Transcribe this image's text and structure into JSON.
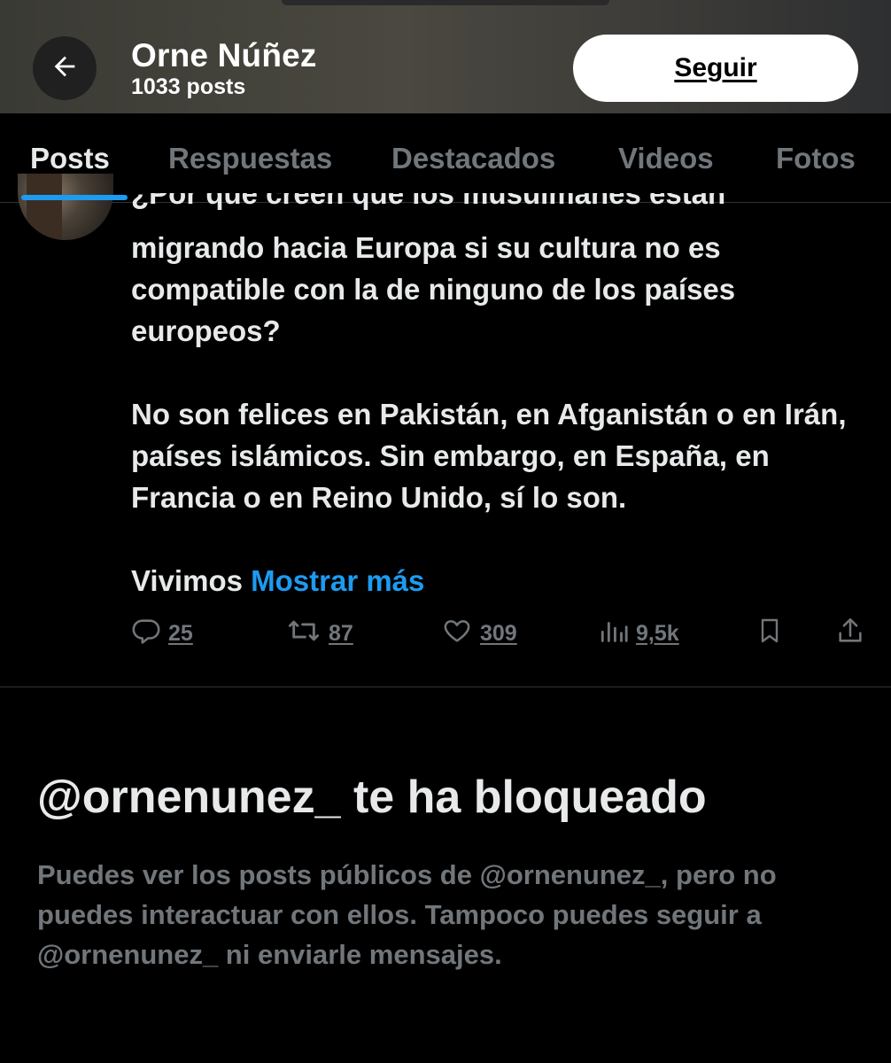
{
  "header": {
    "display_name": "Orne Núñez",
    "post_count": "1033 posts",
    "follow_label": "Seguir",
    "back_icon": "arrow-left-icon"
  },
  "tabs": [
    {
      "label": "Posts",
      "active": true
    },
    {
      "label": "Respuestas",
      "active": false
    },
    {
      "label": "Destacados",
      "active": false
    },
    {
      "label": "Videos",
      "active": false
    },
    {
      "label": "Fotos",
      "active": false
    }
  ],
  "post": {
    "partial_first_line": "¿Por qué creen que los musulmanes están",
    "paragraph1": "migrando hacia Europa si su cultura no es compatible con la de ninguno de los países europeos?",
    "paragraph2": "No son felices en Pakistán, en Afganistán o en Irán, países islámicos. Sin embargo, en España, en Francia o en Reino Unido, sí lo son.",
    "truncated_text": "Vivimos",
    "show_more_label": "Mostrar más",
    "actions": {
      "replies": "25",
      "reposts": "87",
      "likes": "309",
      "views": "9,5k"
    }
  },
  "blocked": {
    "title": "@ornenunez_ te ha bloqueado",
    "description": "Puedes ver los posts públicos de @ornenunez_, pero no puedes interactuar con ellos. Tampoco puedes seguir a @ornenunez_ ni enviarle mensajes."
  },
  "colors": {
    "accent": "#1d9bf0",
    "muted": "#71767b",
    "text": "#e7e9ea",
    "background": "#000000"
  }
}
